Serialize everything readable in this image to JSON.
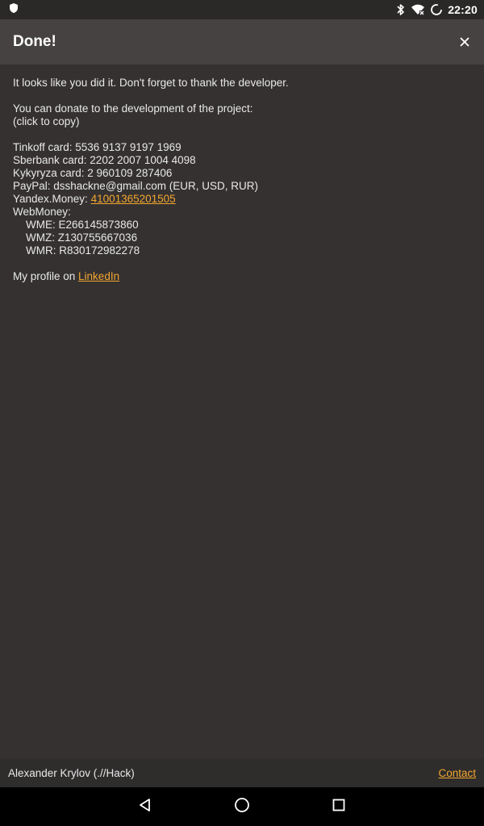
{
  "status_bar": {
    "time": "22:20",
    "left_icon": "shield-icon",
    "right_icons": [
      "bluetooth-icon",
      "wifi-icon",
      "battery-charging-icon"
    ]
  },
  "app_bar": {
    "title": "Done!",
    "close_icon": "close-icon"
  },
  "content": {
    "intro": "It looks like you did it. Don't forget to thank the developer.",
    "donate_line": "You can donate to the development of the project:",
    "copy_hint": "(click to copy)",
    "tinkoff": "Tinkoff card: 5536 9137 9197 1969",
    "sberbank": "Sberbank card: 2202 2007 1004 4098",
    "kykyryza": "Kykyryza card: 2 960109 287406",
    "paypal": "PayPal: dsshackne@gmail.com (EUR, USD, RUR)",
    "yandex_label": "Yandex.Money: ",
    "yandex_link": "41001365201505",
    "webmoney_label": "WebMoney:",
    "wme": "WME: E266145873860",
    "wmz": "WMZ: Z130755667036",
    "wmr": "WMR: R830172982278",
    "profile_label": "My profile on ",
    "linkedin_link": "LinkedIn"
  },
  "footer": {
    "author": "Alexander Krylov (.//Hack)",
    "contact_link": "Contact"
  },
  "nav_bar": {
    "icons": [
      "back-icon",
      "home-icon",
      "recents-icon"
    ]
  },
  "colors": {
    "background": "#353131",
    "app_bar": "#464242",
    "link": "#f2a72f",
    "footer": "#2f2c2c",
    "nav_bar": "#000000"
  }
}
